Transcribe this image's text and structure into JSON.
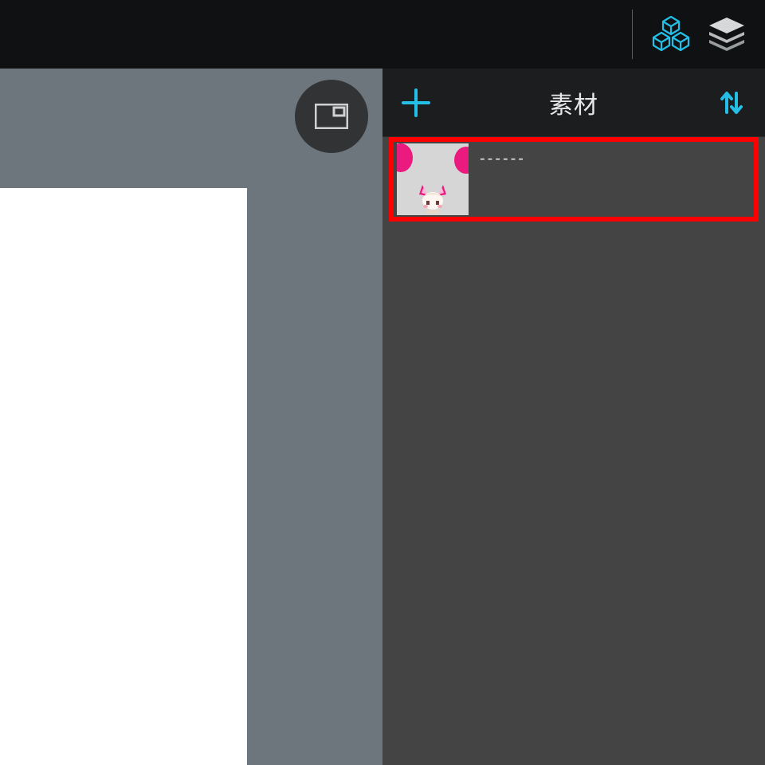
{
  "topbar": {
    "icons": {
      "cubes": "cubes-icon",
      "layers": "layers-icon"
    }
  },
  "canvas": {
    "overlay_button": "view-reference-toggle"
  },
  "panel": {
    "title": "素材",
    "add_icon": "add-icon",
    "sort_icon": "sort-swap-icon"
  },
  "materials": [
    {
      "name": "------",
      "thumb": "character-sprite"
    }
  ],
  "colors": {
    "accent": "#23bfe7",
    "highlight": "#ff0000",
    "magenta": "#ea1a7f"
  }
}
